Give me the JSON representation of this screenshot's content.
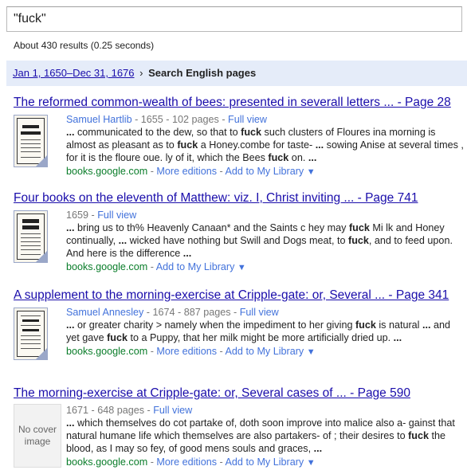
{
  "search": {
    "query": "\"fuck\""
  },
  "stats": "About 430 results (0.25 seconds)",
  "filter": {
    "date_range": "Jan 1, 1650–Dec 31, 1676",
    "sep": "›",
    "scope": "Search English pages"
  },
  "labels": {
    "full_view": "Full view",
    "more_editions": "More editions",
    "add_library": "Add to My Library",
    "dash": " - ",
    "no_cover": "No cover image",
    "triangle": "▼"
  },
  "results": [
    {
      "title": "The reformed common-wealth of bees: presented in severall letters ... - Page 28",
      "author": "Samuel Hartlib",
      "meta": " - 1655 - 102 pages - ",
      "snippet_html": "<b>...</b> communicated to the dew, so that to <b>fuck</b> such clusters of Floures ina morning is almost as pleasant as to <b>fuck</b> a Honey.combe for taste- <b>...</b> sowing Anise at several times , for it is the floure oue. ly of it, which the Bees <b>fuck</b> on. <b>...</b>",
      "url": "books.google.com",
      "more_editions": true
    },
    {
      "title": "Four books on the eleventh of Matthew: viz. I, Christ inviting ... - Page 741",
      "author": "",
      "meta": "1659 - ",
      "snippet_html": "<b>...</b> bring us to th% Heavenly Canaan* and the Saints c hey may <b>fuck</b> Mi lk and Honey continually, <b>...</b> wicked have nothing but Swill and Dogs meat, to <b>fuck</b>, and to feed upon. And here is the difference <b>...</b>",
      "url": "books.google.com",
      "more_editions": false
    },
    {
      "title": "A supplement to the morning-exercise at Cripple-gate: or, Several ... - Page 341",
      "author": "Samuel Annesley",
      "meta": " - 1674 - 887 pages - ",
      "snippet_html": "<b>...</b> or greater charity &gt; namely when the impediment to her giving <b>fuck</b> is natural <b>...</b> and yet gave <b>fuck</b> to a Puppy, that her milk might be more artificially dried up. <b>...</b>",
      "url": "books.google.com",
      "more_editions": true
    },
    {
      "title": "The morning-exercise at Cripple-gate: or, Several cases of ... - Page 590",
      "author": "",
      "meta": "1671 - 648 pages - ",
      "snippet_html": "<b>...</b> which themselves do cot partake of, doth soon improve into malice also a- gainst that natural humane life which themselves are also partakers- of ; their desires to <b>fuck</b> the blood, as I may so fey, of good mens souls and graces, <b>...</b>",
      "url": "books.google.com",
      "more_editions": true
    }
  ]
}
